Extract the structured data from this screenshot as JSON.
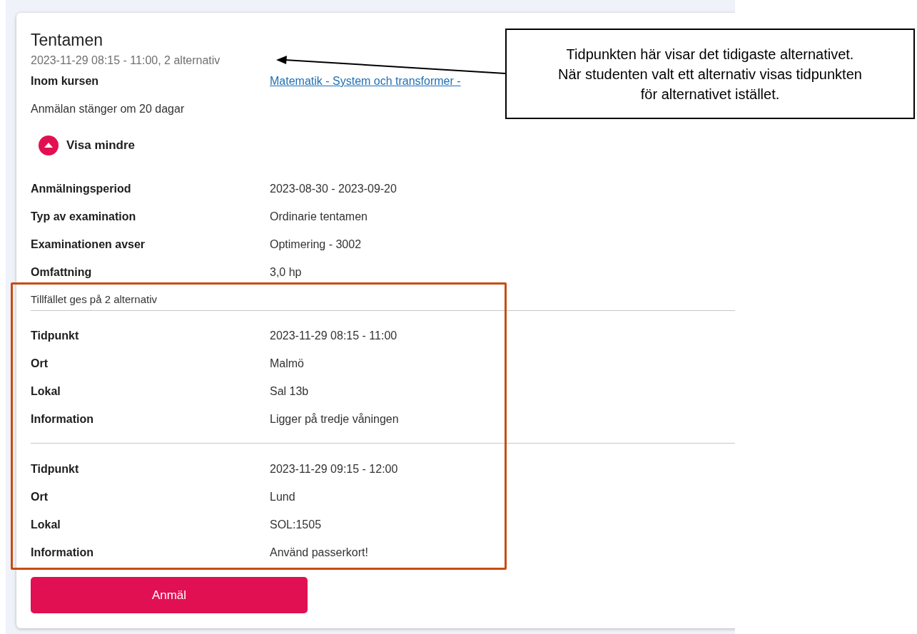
{
  "card": {
    "title": "Tentamen",
    "subtitle": "2023-11-29 08:15 - 11:00, 2 alternativ",
    "course": {
      "label": "Inom kursen",
      "link": "Matematik - System och transformer -"
    },
    "closing_note": "Anmälan stänger om 20 dagar",
    "toggle": {
      "label": "Visa mindre",
      "expanded": true
    },
    "details": [
      {
        "label": "Anmälningsperiod",
        "value": "2023-08-30 - 2023-09-20"
      },
      {
        "label": "Typ av examination",
        "value": "Ordinarie tentamen"
      },
      {
        "label": "Examinationen avser",
        "value": "Optimering - 3002"
      },
      {
        "label": "Omfattning",
        "value": "3,0 hp"
      }
    ],
    "alternatives_heading": "Tillfället ges på 2 alternativ",
    "alternatives": [
      [
        {
          "label": "Tidpunkt",
          "value": "2023-11-29 08:15 - 11:00"
        },
        {
          "label": "Ort",
          "value": "Malmö"
        },
        {
          "label": "Lokal",
          "value": "Sal 13b"
        },
        {
          "label": "Information",
          "value": "Ligger på tredje våningen"
        }
      ],
      [
        {
          "label": "Tidpunkt",
          "value": "2023-11-29 09:15 - 12:00"
        },
        {
          "label": "Ort",
          "value": "Lund"
        },
        {
          "label": "Lokal",
          "value": "SOL:1505"
        },
        {
          "label": "Information",
          "value": "Använd passerkort!"
        }
      ]
    ],
    "button": "Anmäl"
  },
  "annotation": {
    "text": "Tidpunkten här visar det tidigaste alternativet. När studenten valt ett alternativ visas tidpunkten för alternativet istället."
  }
}
